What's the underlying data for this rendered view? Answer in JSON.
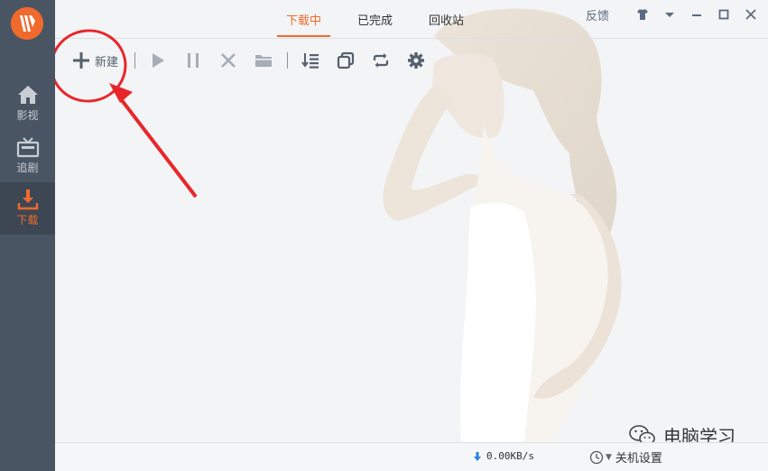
{
  "sidebar": {
    "items": [
      {
        "label": "影视",
        "icon": "home-icon"
      },
      {
        "label": "追剧",
        "icon": "tv-icon"
      },
      {
        "label": "下载",
        "icon": "download-icon",
        "active": true
      }
    ]
  },
  "tabs": [
    {
      "label": "下载中",
      "active": true
    },
    {
      "label": "已完成"
    },
    {
      "label": "回收站"
    }
  ],
  "window": {
    "feedback_label": "反馈"
  },
  "toolbar": {
    "new_label": "新建"
  },
  "status": {
    "speed": "0.00KB/s",
    "shutdown_label": "关机设置"
  },
  "watermark": {
    "text": "电脑学习"
  },
  "colors": {
    "accent": "#ef6a2c",
    "sidebar_bg": "#4a5564",
    "annotation_red": "#e8262a"
  }
}
